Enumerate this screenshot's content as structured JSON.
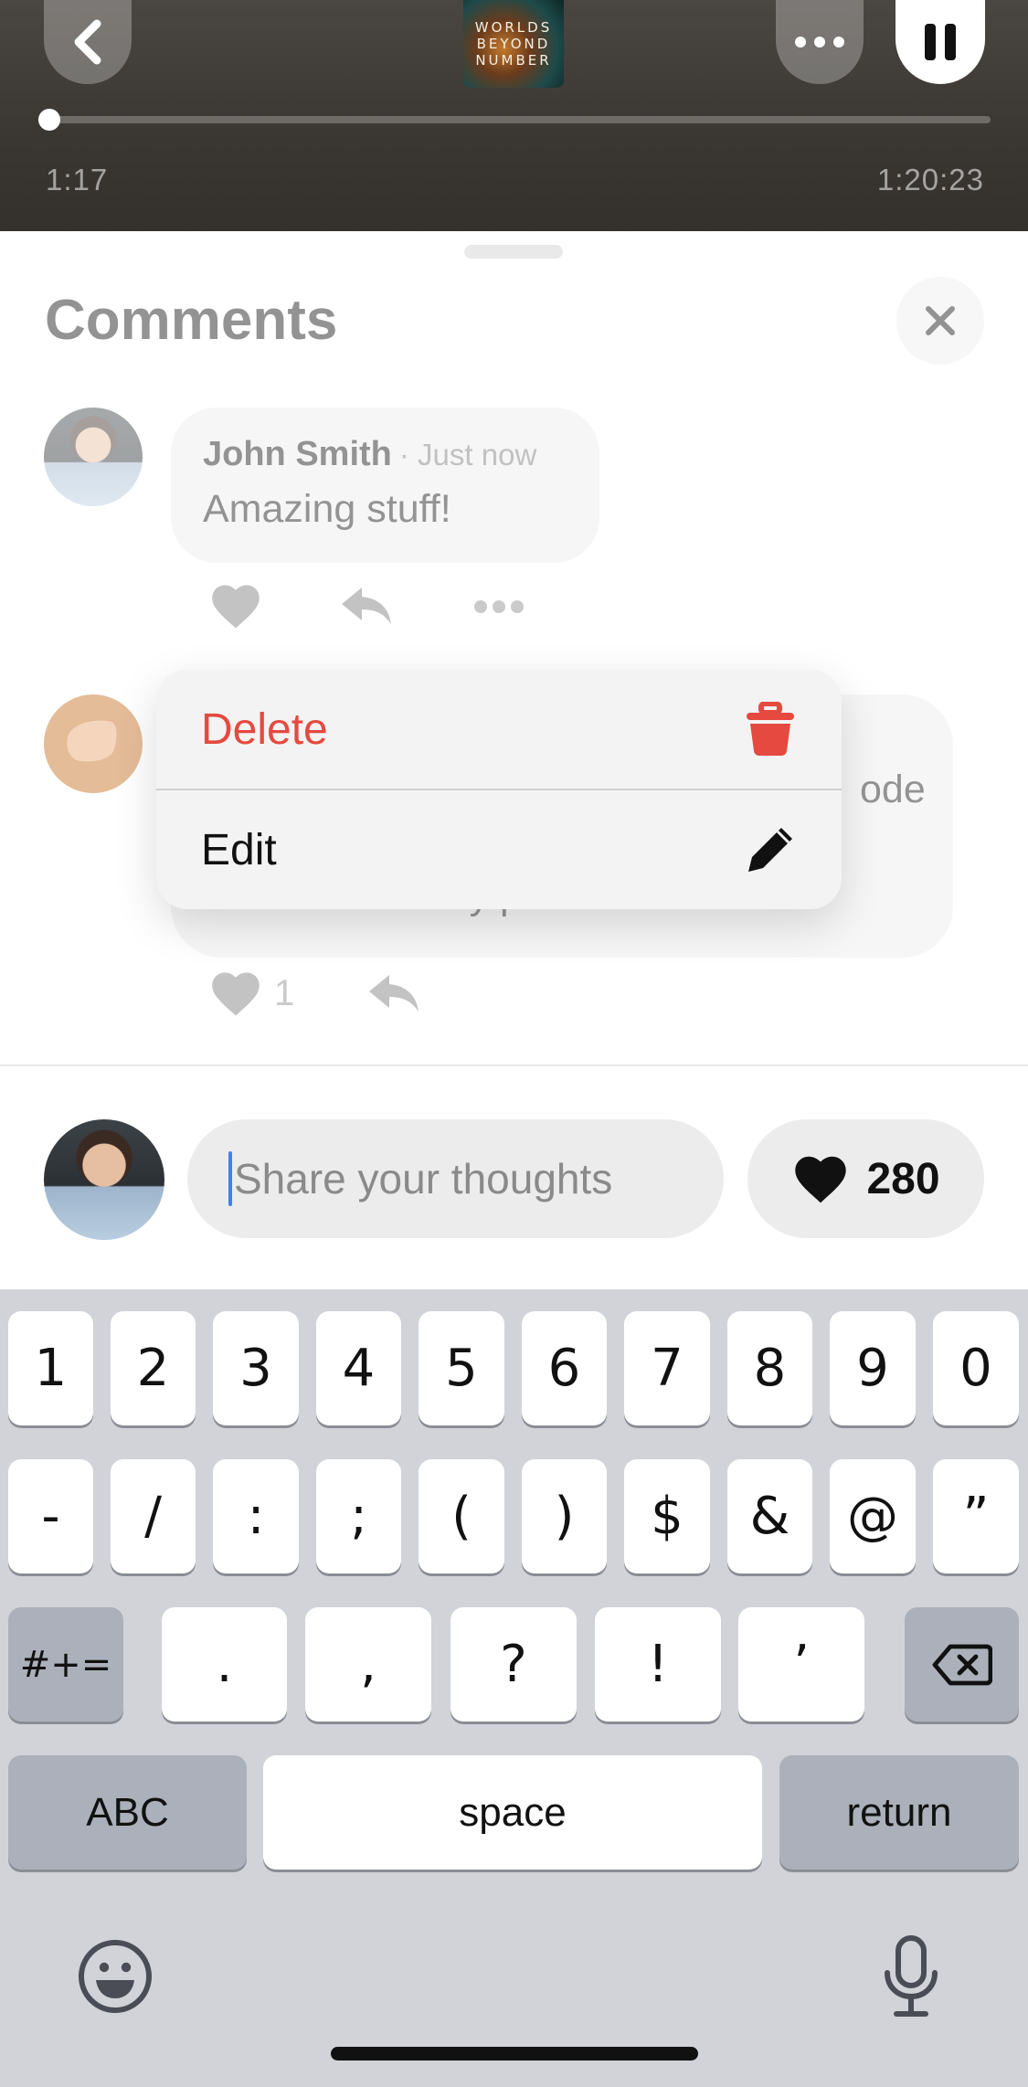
{
  "player": {
    "cover_lines": [
      "WORLDS",
      "BEYOND",
      "NUMBER"
    ],
    "elapsed": "1:17",
    "remaining": "1:20:23",
    "progress_fraction": 0.01
  },
  "sheet": {
    "title": "Comments"
  },
  "comments": [
    {
      "author": "John Smith",
      "time": "· Just now",
      "text": "Amazing stuff!"
    },
    {
      "text_visible_fragment": "ode",
      "text_line2_fragment": "included! Pwetty pwease",
      "likes": "1"
    }
  ],
  "context_menu": {
    "delete_label": "Delete",
    "edit_label": "Edit",
    "delete_color": "#e5493f"
  },
  "composer": {
    "placeholder": "Share your thoughts",
    "likes_total": "280"
  },
  "keyboard": {
    "row1": [
      "1",
      "2",
      "3",
      "4",
      "5",
      "6",
      "7",
      "8",
      "9",
      "0"
    ],
    "row2": [
      "-",
      "/",
      ":",
      ";",
      "(",
      ")",
      "$",
      "&",
      "@",
      "”"
    ],
    "row3_mode": "#+=",
    "row3": [
      ".",
      ",",
      "?",
      "!",
      "’"
    ],
    "abc": "ABC",
    "space": "space",
    "return": "return"
  },
  "icons": {
    "back": "chevron-left-icon",
    "more": "ellipsis-icon",
    "pause": "pause-icon",
    "close": "close-icon",
    "like": "heart-icon",
    "reply": "reply-icon",
    "trash": "trash-icon",
    "edit": "pencil-icon",
    "backspace": "backspace-icon",
    "emoji": "emoji-icon",
    "mic": "microphone-icon"
  }
}
